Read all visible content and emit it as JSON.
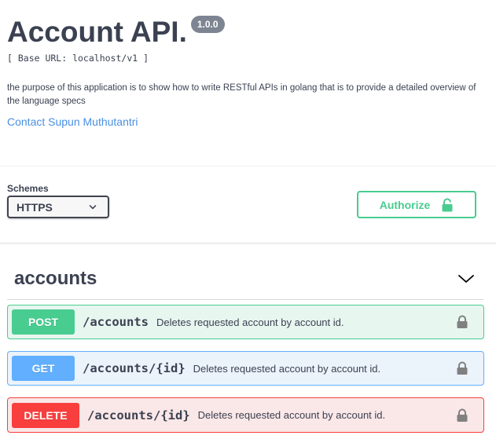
{
  "info": {
    "title": "Account API.",
    "version": "1.0.0",
    "base_url": "[ Base URL: localhost/v1 ]",
    "description": "the purpose of this application is to show how to write RESTful APIs in golang that is to provide a detailed overview of the language specs",
    "contact": "Contact Supun Muthutantri"
  },
  "schemes": {
    "label": "Schemes",
    "selected": "HTTPS"
  },
  "authorize": {
    "label": "Authorize"
  },
  "tag": {
    "name": "accounts"
  },
  "operations": [
    {
      "method": "POST",
      "path": "/accounts",
      "summary": "Deletes requested account by account id."
    },
    {
      "method": "GET",
      "path": "/accounts/{id}",
      "summary": "Deletes requested account by account id."
    },
    {
      "method": "DELETE",
      "path": "/accounts/{id}",
      "summary": "Deletes requested account by account id."
    }
  ],
  "colors": {
    "post": "#49cc90",
    "get": "#61affe",
    "delete": "#f93e3e",
    "link": "#4990e2"
  },
  "icons": {
    "lock": "lock-icon",
    "chevron": "chevron-down-icon"
  }
}
